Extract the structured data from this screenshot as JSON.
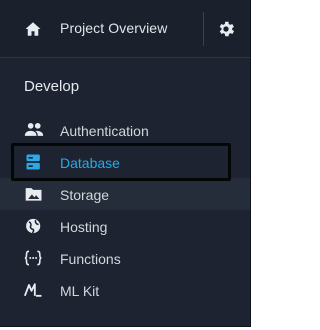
{
  "header": {
    "title": "Project Overview",
    "home_icon": "home-icon",
    "settings_icon": "gear-icon"
  },
  "section_label": "Develop",
  "nav": {
    "items": [
      {
        "label": "Authentication",
        "icon": "people-icon"
      },
      {
        "label": "Database",
        "icon": "database-icon",
        "active": true
      },
      {
        "label": "Storage",
        "icon": "image-folder-icon"
      },
      {
        "label": "Hosting",
        "icon": "globe-icon"
      },
      {
        "label": "Functions",
        "icon": "functions-icon"
      },
      {
        "label": "ML Kit",
        "icon": "ml-kit-icon"
      }
    ]
  },
  "colors": {
    "background": "#1d2330",
    "active_text": "#2aa9e6",
    "text": "#d2d6dd"
  }
}
